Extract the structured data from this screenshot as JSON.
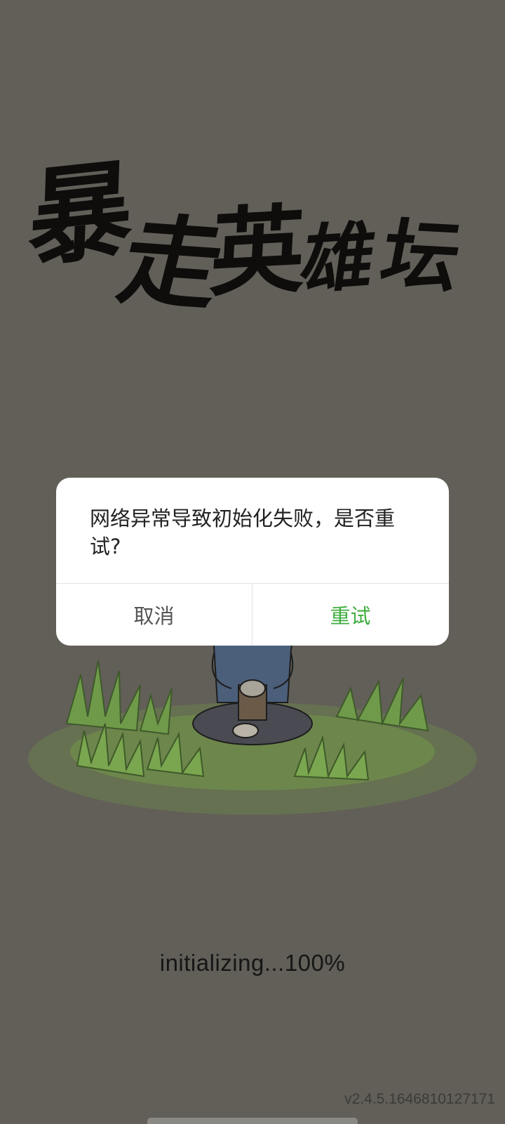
{
  "logo": {
    "chars": [
      "暴",
      "走",
      "英",
      "雄",
      "坛"
    ]
  },
  "dialog": {
    "message": "网络异常导致初始化失败，是否重试?",
    "cancel_label": "取消",
    "retry_label": "重试",
    "retry_color": "#3fae3f"
  },
  "loading": {
    "text": "initializing...100%"
  },
  "version": "v2.4.5.1646810127171",
  "colors": {
    "background": "#615f58",
    "grass": "#6f9a4a",
    "character_outfit": "#4b5f7a"
  }
}
